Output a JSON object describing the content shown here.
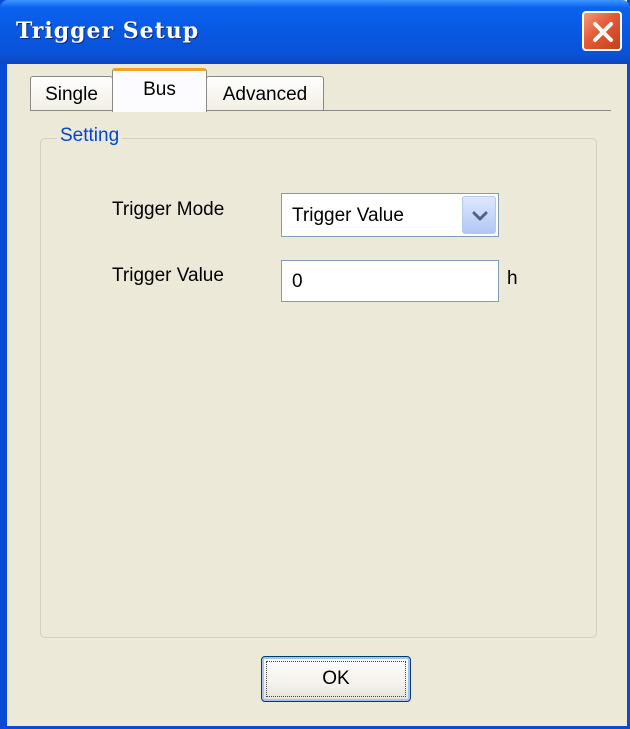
{
  "window": {
    "title": "Trigger Setup",
    "close_icon": "close-x-icon"
  },
  "tabs": [
    {
      "label": "Single",
      "selected": false
    },
    {
      "label": "Bus",
      "selected": true
    },
    {
      "label": "Advanced",
      "selected": false
    }
  ],
  "group": {
    "legend": "Setting"
  },
  "form": {
    "trigger_mode_label": "Trigger Mode",
    "trigger_mode_value": "Trigger Value",
    "trigger_value_label": "Trigger Value",
    "trigger_value_value": "0",
    "trigger_value_unit": "h"
  },
  "buttons": {
    "ok_label": "OK"
  },
  "colors": {
    "titlebar": "#0a52d6",
    "close_button": "#e35a36",
    "selected_tab_accent": "#f4a22a",
    "group_legend": "#0046d5",
    "dialog_background": "#ece9d8"
  }
}
